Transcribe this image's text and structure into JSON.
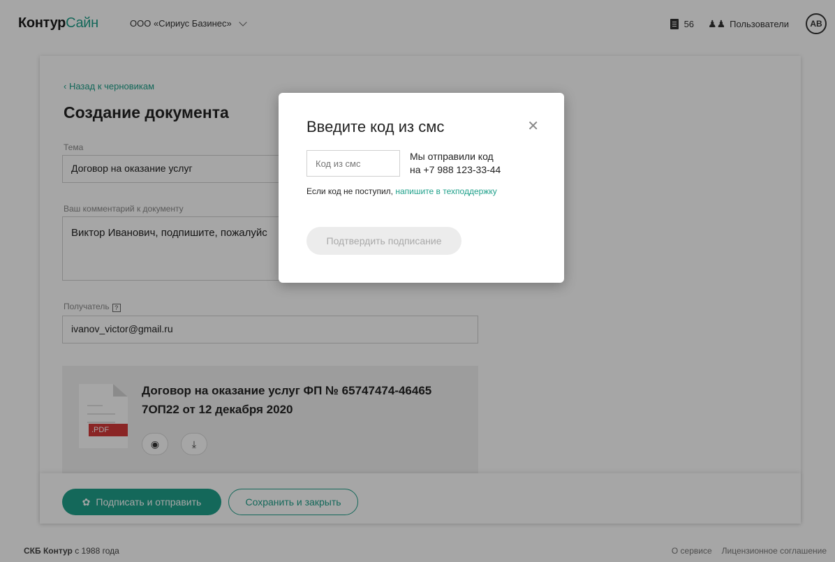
{
  "header": {
    "logo_part1": "Контур",
    "logo_part2": "Сайн",
    "org_name": "ООО «Сириус Базинес»",
    "docs_count": "56",
    "users_label": "Пользователи",
    "avatar_initials": "АВ"
  },
  "page": {
    "back_link": "Назад к черновикам",
    "title": "Создание документа",
    "topic_label": "Тема",
    "topic_value": "Договор на оказание услуг",
    "comment_label": "Ваш комментарий к документу",
    "comment_value": "Виктор Иванович, подпишите, пожалуйс",
    "recipient_label": "Получатель",
    "recipient_hint": "?",
    "recipient_value": "ivanov_victor@gmail.ru",
    "attachment": {
      "file_type": ".PDF",
      "name": "Договор на оказание услуг ФП № 65747474-46465 7ОП22 от 12 декабря 2020",
      "view_icon": "eye-icon",
      "download_icon": "download-icon"
    },
    "sign_button": "Подписать и отправить",
    "save_button": "Сохранить и закрыть"
  },
  "footer": {
    "company": "СКБ Контур",
    "since": "с 1988 года",
    "about": "О сервисе",
    "license": "Лицензионное соглашение"
  },
  "modal": {
    "title": "Введите код из смс",
    "code_placeholder": "Код из смс",
    "sent_line1": "Мы отправили код",
    "sent_line2": "на +7 988 123-33-44",
    "help_text": "Если код не поступил,",
    "help_link": "напишите в техподдержку",
    "confirm_button": "Подтвердить подписание"
  },
  "colors": {
    "accent": "#1fa08a",
    "pdf_tag": "#d43a3a",
    "overlay": "rgba(0,0,0,0.35)"
  }
}
